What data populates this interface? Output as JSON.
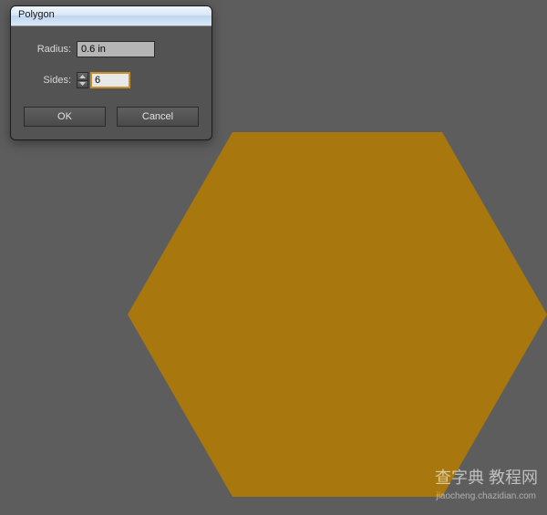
{
  "dialog": {
    "title": "Polygon",
    "radius_label": "Radius:",
    "radius_value": "0.6 in",
    "sides_label": "Sides:",
    "sides_value": "6",
    "ok_label": "OK",
    "cancel_label": "Cancel"
  },
  "hexagon": {
    "fill": "#a8780e"
  },
  "watermark": {
    "main": "查字典 教程网",
    "sub": "jiaocheng.chazidian.com"
  }
}
